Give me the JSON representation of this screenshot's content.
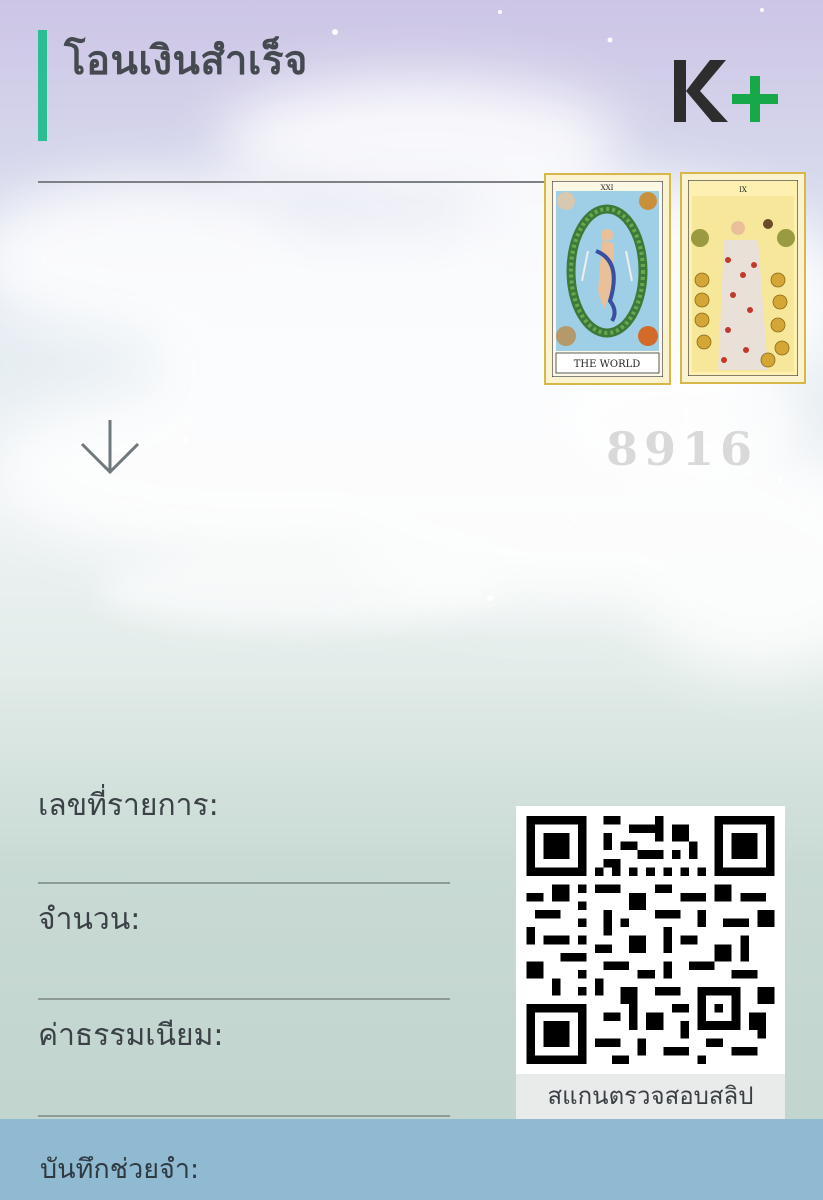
{
  "header": {
    "title": "โอนเงินสำเร็จ",
    "brand": "K+",
    "brand_colors": {
      "k": "#2d2d2d",
      "plus": "#17a84a"
    }
  },
  "cards": [
    {
      "numeral": "XXI",
      "caption": "THE WORLD"
    },
    {
      "numeral": "IX",
      "caption": ""
    }
  ],
  "reference_number": "8916",
  "icons": {
    "down_arrow": "arrow-down-icon"
  },
  "fields": [
    {
      "label": "เลขที่รายการ:"
    },
    {
      "label": "จำนวน:"
    },
    {
      "label": "ค่าธรรมเนียม:"
    }
  ],
  "qr": {
    "caption": "สแกนตรวจสอบสลิป"
  },
  "footer": {
    "label": "บันทึกช่วยจำ:"
  },
  "colors": {
    "accent": "#2bbd93",
    "footer": "#8fbad2"
  }
}
